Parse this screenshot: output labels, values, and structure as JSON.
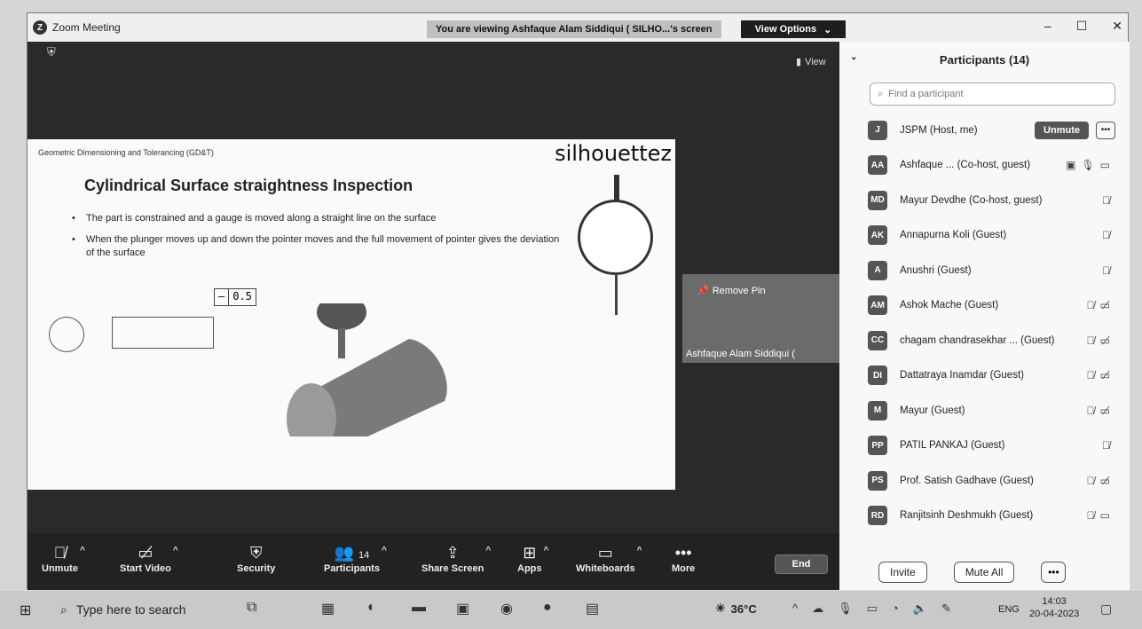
{
  "window": {
    "title": "Zoom Meeting",
    "viewing_banner": "You are viewing Ashfaque Alam Siddiqui ( SILHO...'s screen",
    "view_options": "View Options",
    "controls": [
      "–",
      "☐",
      "✕"
    ]
  },
  "meeting": {
    "view_label": "View"
  },
  "slide": {
    "header": "Geometric Dimensioning and Tolerancing (GD&T)",
    "brand": "silhouettez",
    "title": "Cylindrical Surface  straightness Inspection",
    "bullets": [
      "The part is constrained and a gauge is moved along a straight line on the surface",
      "When the plunger moves up and down the pointer moves and the full movement of pointer gives the deviation of the surface"
    ],
    "tolerance_symbol": "—",
    "tolerance_value": "0.5"
  },
  "video": {
    "remove_pin": "Remove Pin",
    "name": "Ashfaque Alam Siddiqui ("
  },
  "toolbar": {
    "unmute": "Unmute",
    "start_video": "Start Video",
    "security": "Security",
    "participants": "Participants",
    "participants_count": "14",
    "share_screen": "Share Screen",
    "apps": "Apps",
    "whiteboards": "Whiteboards",
    "more": "More",
    "end": "End"
  },
  "participants": {
    "title": "Participants (14)",
    "search_placeholder": "Find a participant",
    "list": [
      {
        "initials": "J",
        "name": "JSPM (Host, me)"
      },
      {
        "initials": "AA",
        "name": "Ashfaque ... (Co-host, guest)"
      },
      {
        "initials": "MD",
        "name": "Mayur Devdhe (Co-host, guest)"
      },
      {
        "initials": "AK",
        "name": "Annapurna Koli (Guest)"
      },
      {
        "initials": "A",
        "name": "Anushri (Guest)"
      },
      {
        "initials": "AM",
        "name": "Ashok Mache (Guest)"
      },
      {
        "initials": "CC",
        "name": "chagam chandrasekhar ... (Guest)"
      },
      {
        "initials": "DI",
        "name": "Dattatraya Inamdar (Guest)"
      },
      {
        "initials": "M",
        "name": "Mayur (Guest)"
      },
      {
        "initials": "PP",
        "name": "PATIL PANKAJ (Guest)"
      },
      {
        "initials": "PS",
        "name": "Prof. Satish Gadhave (Guest)"
      },
      {
        "initials": "RD",
        "name": "Ranjitsinh Deshmukh (Guest)"
      }
    ],
    "unmute_label": "Unmute",
    "invite": "Invite",
    "mute_all": "Mute All"
  },
  "taskbar": {
    "search_placeholder": "Type here to search",
    "temperature": "36°C",
    "language": "ENG",
    "time": "14:03",
    "date": "20-04-2023"
  }
}
